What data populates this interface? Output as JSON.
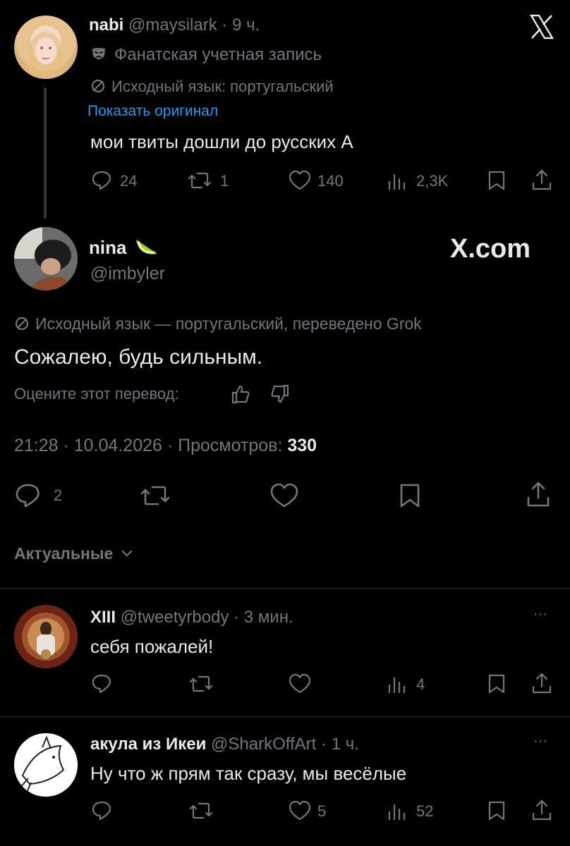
{
  "quoted_tweet": {
    "display_name": "nabi",
    "handle": "@maysilark",
    "time": "9 ч.",
    "fan_account_label": "Фанатская учетная запись",
    "translation_note": "Исходный язык: португальский",
    "show_original": "Показать оригинал",
    "text": "мои твиты дошли до русских А",
    "stats": {
      "replies": "24",
      "retweets": "1",
      "likes": "140",
      "views": "2,3K"
    }
  },
  "x_logo": "X",
  "main_tweet": {
    "display_name": "nina",
    "handle": "@imbyler",
    "xcom_label": "X.com",
    "translation_note": "Исходный язык — португальский, переведено Grok",
    "text": "Сожалею, будь сильным.",
    "rate_prompt": "Оцените этот перевод:",
    "timestamp": "21:28 · 10.04.2026 · Просмотров:",
    "views": "330",
    "stats": {
      "replies": "2"
    }
  },
  "sort": {
    "label": "Актуальные"
  },
  "replies": [
    {
      "display_name": "XIII",
      "handle": "@tweetyrbody",
      "time": "3 мин.",
      "text": "себя пожалей!",
      "more": "···",
      "stats": {
        "views": "4"
      }
    },
    {
      "display_name": "акула из Икеи",
      "handle": "@SharkOffArt",
      "time": "1 ч.",
      "text": "Ну что ж прям так сразу, мы весёлые",
      "more": "···",
      "stats": {
        "likes": "5",
        "views": "52"
      }
    }
  ],
  "colors": {
    "background": "#000000",
    "text": "#e7e9ea",
    "muted": "#71767b",
    "link": "#1d9bf0",
    "divider": "#2f3336"
  }
}
